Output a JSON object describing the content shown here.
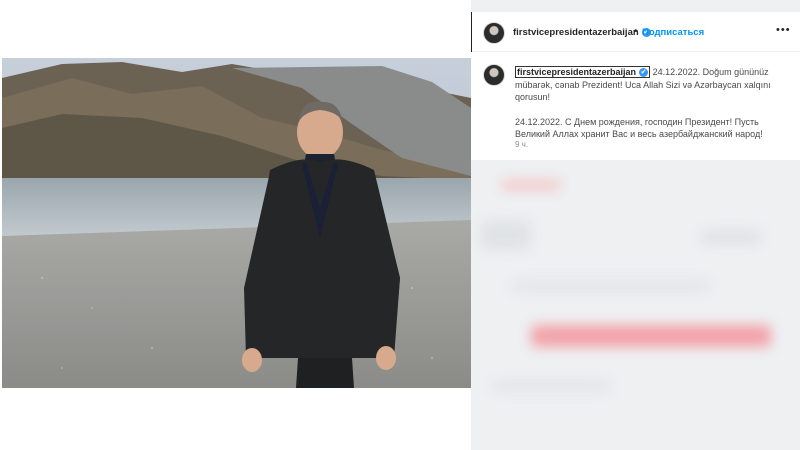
{
  "post": {
    "username": "firstvicepresidentazerbaijan",
    "verified_symbol": "✔",
    "follow_label": "Подписаться",
    "separator": "•",
    "more_label": "•••",
    "caption_az": "24.12.2022. Doğum gününüz mübarək, cənab Prezident! Uca Allah Sizi və Azərbaycan xalqını qorusun!",
    "caption_ru": "24.12.2022. С Днем рождения, господин Президент! Пусть Великий Аллах хранит Вас и весь азербайджанский народ!",
    "time_ago": "9 ч."
  },
  "colors": {
    "accent": "#0095f6",
    "verified": "#3897f0",
    "text": "#262626",
    "muted": "#8e8e8e"
  },
  "icons": {
    "avatar": "profile-avatar",
    "verified": "verified-badge-icon",
    "more": "more-options-icon"
  }
}
